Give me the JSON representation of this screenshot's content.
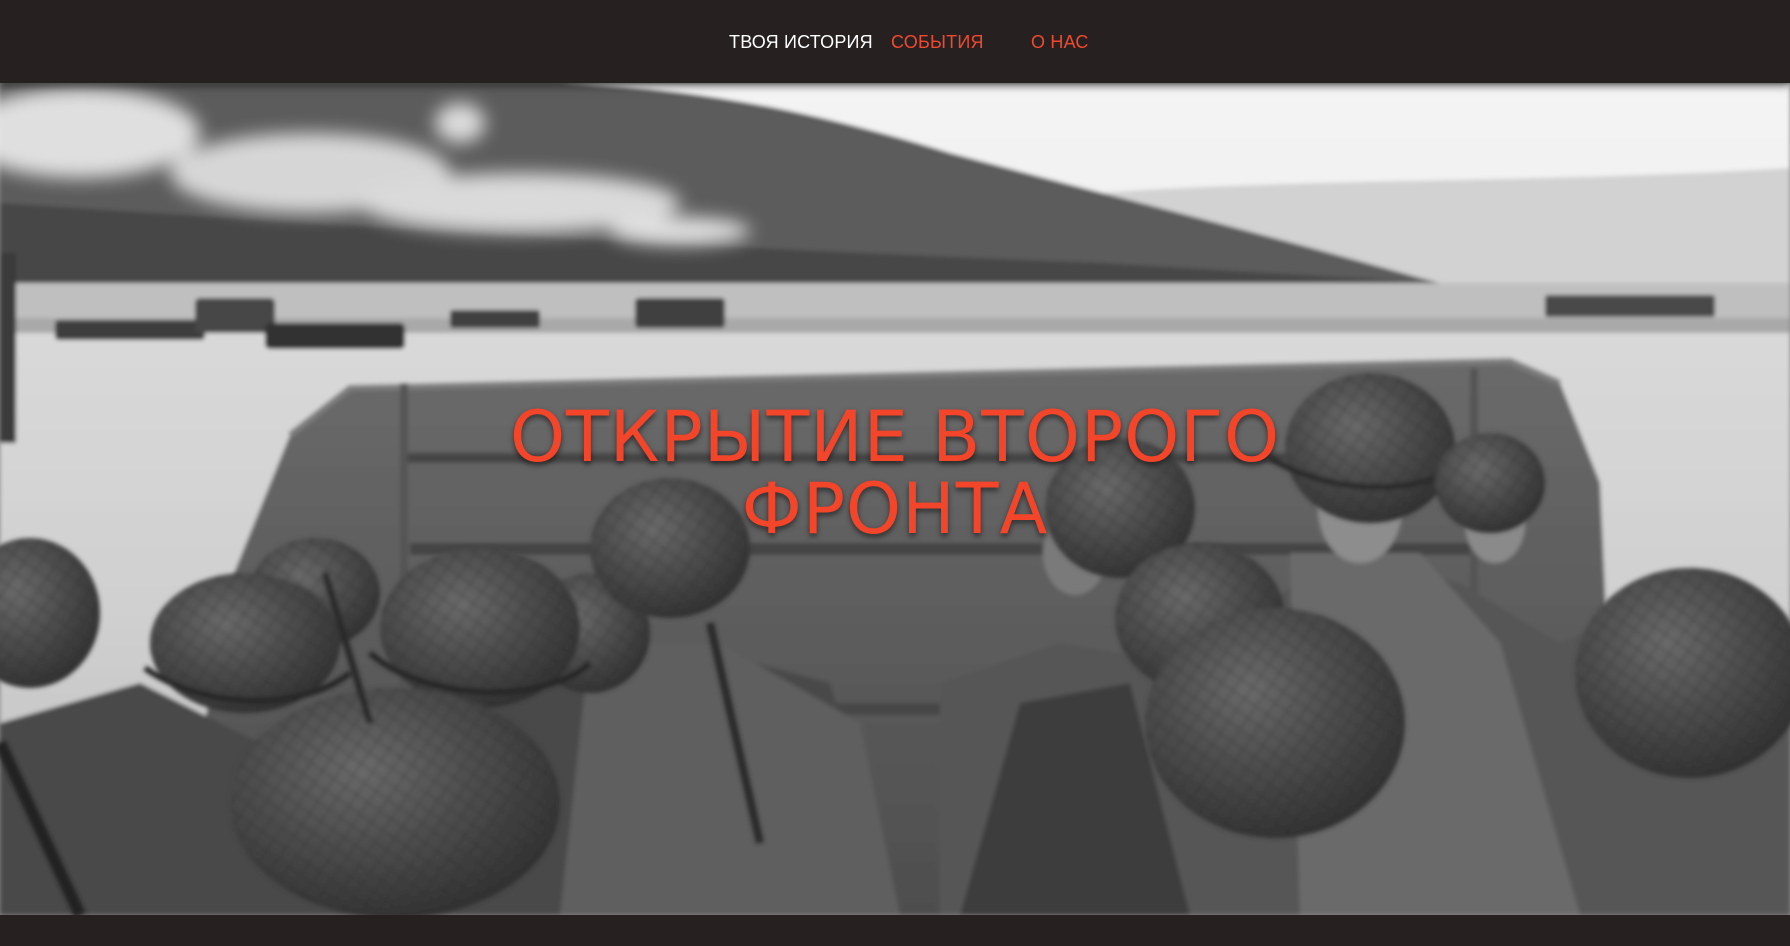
{
  "nav": {
    "items": [
      {
        "label": "ТВОЯ ИСТОРИЯ"
      },
      {
        "label": "СОБЫТИЯ"
      },
      {
        "label": "О НАС"
      }
    ]
  },
  "hero": {
    "title_line1": "ОТКРЫТИЕ ВТОРОГО",
    "title_line2": "ФРОНТА",
    "image": "black-and-white photo of soldiers in helmets in a landing craft approaching a beach"
  },
  "colors": {
    "background": "#262021",
    "accent": "#ef4a2f",
    "nav_active": "#ffffff"
  }
}
